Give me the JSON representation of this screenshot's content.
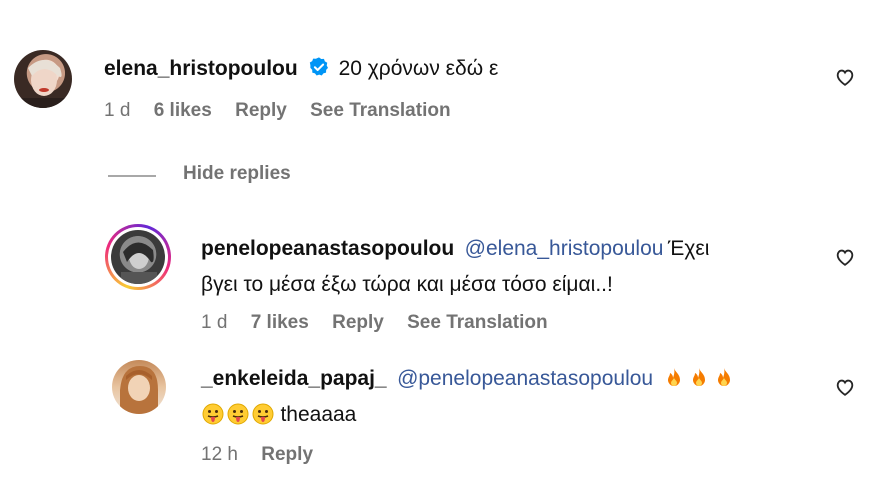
{
  "comment1": {
    "username": "elena_hristopoulou",
    "verified_icon": "verified-badge-icon",
    "text": "20 χρόνων εδώ ε",
    "time": "1 d",
    "likes": "6 likes",
    "reply": "Reply",
    "see_translation": "See Translation"
  },
  "hide_replies": "Hide replies",
  "reply1": {
    "username": "penelopeanastasopoulou",
    "mention": "@elena_hristopoulou",
    "text_line1": "Έχει",
    "text_line2": "βγει το μέσα έξω τώρα και μέσα τόσο είμαι..!",
    "time": "1 d",
    "likes": "7 likes",
    "reply": "Reply",
    "see_translation": "See Translation"
  },
  "reply2": {
    "username": "_enkeleida_papaj_",
    "mention": "@penelopeanastasopoulou",
    "fire_emojis": [
      "fire",
      "fire",
      "fire"
    ],
    "tongue_emojis": [
      "face-with-tongue",
      "face-with-tongue",
      "face-with-tongue"
    ],
    "text": "theaaaa",
    "time": "12 h",
    "reply": "Reply"
  },
  "colors": {
    "accent_link": "#385898",
    "meta_gray": "#737373",
    "verified_blue": "#0095f6"
  }
}
